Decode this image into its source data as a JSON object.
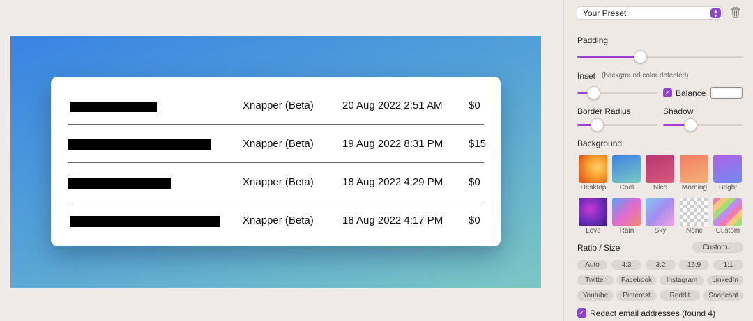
{
  "canvas": {
    "rows": [
      {
        "app": "Xnapper (Beta)",
        "date": "20 Aug 2022 2:51 AM",
        "amount": "$0"
      },
      {
        "app": "Xnapper (Beta)",
        "date": "19 Aug 2022 8:31 PM",
        "amount": "$15"
      },
      {
        "app": "Xnapper (Beta)",
        "date": "18 Aug 2022 4:29 PM",
        "amount": "$0"
      },
      {
        "app": "Xnapper (Beta)",
        "date": "18 Aug 2022 4:17 PM",
        "amount": "$0"
      }
    ]
  },
  "sidebar": {
    "preset": {
      "value": "Your Preset"
    },
    "padding": {
      "label": "Padding",
      "value": 0.38
    },
    "inset": {
      "label": "Inset",
      "note": "(background color detected)",
      "value": 0.2
    },
    "balance": {
      "label": "Balance",
      "checked": true
    },
    "border_radius": {
      "label": "Border Radius",
      "value": 0.24
    },
    "shadow": {
      "label": "Shadow",
      "value": 0.34
    },
    "background": {
      "label": "Background",
      "items": [
        {
          "name": "Desktop"
        },
        {
          "name": "Cool"
        },
        {
          "name": "Nice"
        },
        {
          "name": "Morning"
        },
        {
          "name": "Bright"
        },
        {
          "name": "Love"
        },
        {
          "name": "Rain"
        },
        {
          "name": "Sky"
        },
        {
          "name": "None"
        },
        {
          "name": "Custom"
        }
      ]
    },
    "ratio": {
      "label": "Ratio / Size",
      "custom_button": "Custom...",
      "options": [
        "Auto",
        "4:3",
        "3:2",
        "16:9",
        "1:1",
        "Twitter",
        "Facebook",
        "Instagram",
        "LinkedIn",
        "Youtube",
        "Pinterest",
        "Reddit",
        "Snapchat"
      ]
    },
    "redact": {
      "label": "Redact email addresses (found 4)",
      "checked": true
    }
  },
  "colors": {
    "accent": "#8e44d1"
  }
}
